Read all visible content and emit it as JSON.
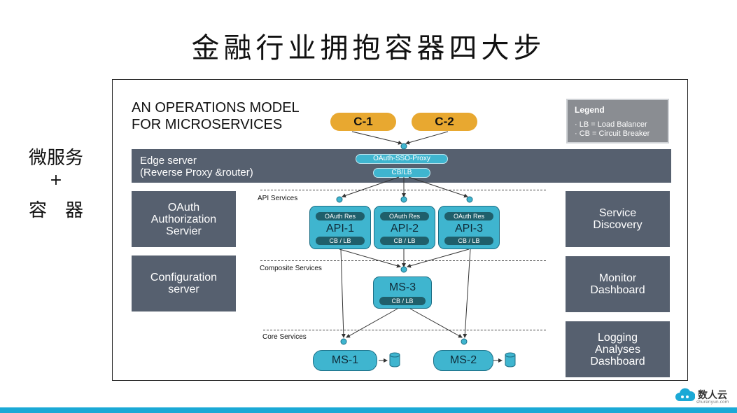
{
  "slide_title": "金融行业拥抱容器四大步",
  "side_note": {
    "line1": "微服务",
    "line2": "+",
    "line3": "容　器"
  },
  "diagram": {
    "title_line1": "AN OPERATIONS MODEL",
    "title_line2": "FOR MICROSERVICES",
    "clients": [
      "C-1",
      "C-2"
    ],
    "legend": {
      "title": "Legend",
      "items": [
        "· LB = Load Balancer",
        "· CB = Circuit Breaker"
      ]
    },
    "edge_server": {
      "line1": "Edge server",
      "line2": "(Reverse Proxy &router)",
      "proxy_label": "OAuth-SSO-Proxy",
      "cb_label": "CB/LB"
    },
    "left_panels": [
      {
        "label": "OAuth Authorization Servier"
      },
      {
        "label": "Configuration server"
      }
    ],
    "right_panels": [
      {
        "label": "Service Discovery"
      },
      {
        "label": "Monitor Dashboard"
      },
      {
        "label": "Logging Analyses Dashboard"
      }
    ],
    "sections": [
      "API Services",
      "Composite Services",
      "Core Services"
    ],
    "api_services": [
      {
        "name": "API-1",
        "top_tag": "OAuth Res",
        "bottom_tag": "CB / LB"
      },
      {
        "name": "API-2",
        "top_tag": "OAuth Res",
        "bottom_tag": "CB / LB"
      },
      {
        "name": "API-3",
        "top_tag": "OAuth Res",
        "bottom_tag": "CB / LB"
      }
    ],
    "composite_services": [
      {
        "name": "MS-3",
        "bottom_tag": "CB / LB"
      }
    ],
    "core_services": [
      {
        "name": "MS-1"
      },
      {
        "name": "MS-2"
      }
    ]
  },
  "brand": {
    "name": "数人云",
    "url": "shurenyun.com"
  },
  "colors": {
    "panel": "#56606f",
    "service": "#3fb5cf",
    "client": "#e8a830",
    "accent_bar": "#1ba9d6"
  }
}
